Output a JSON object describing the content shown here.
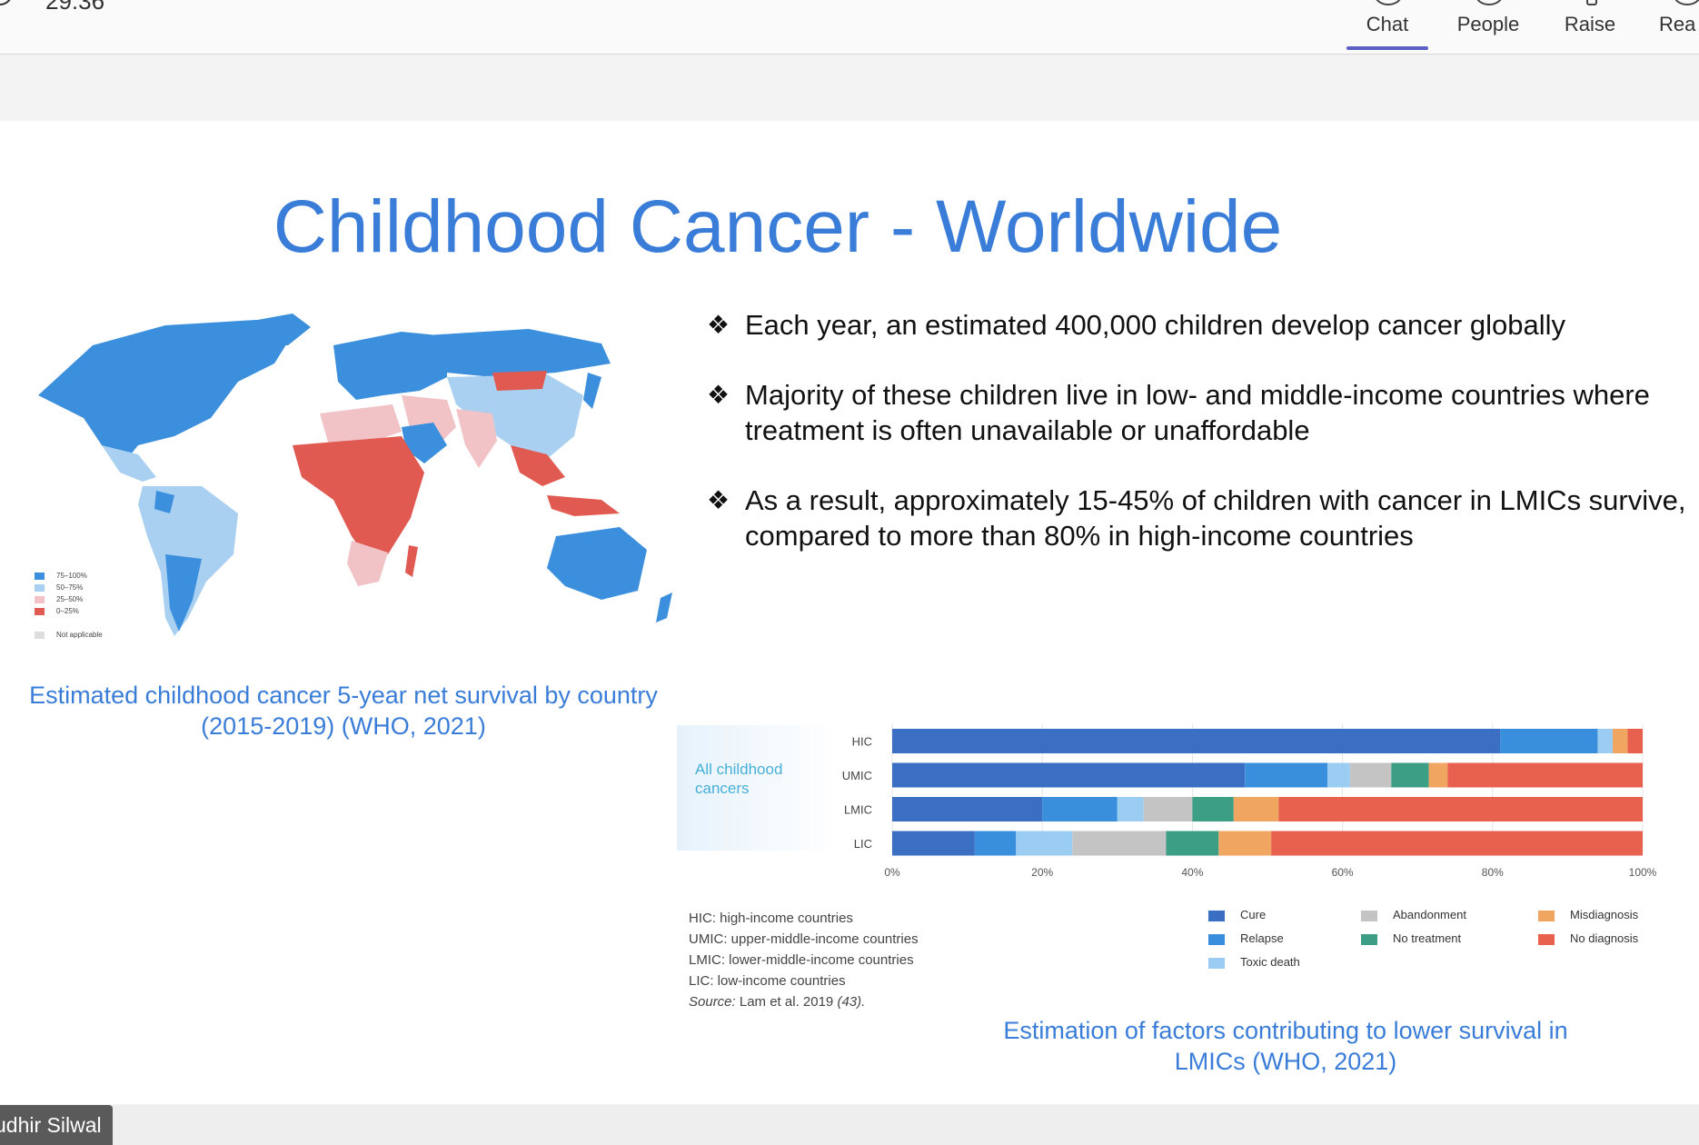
{
  "meeting": {
    "timer": "29:36",
    "toolbar": [
      {
        "label": "Chat",
        "icon": "chat-icon"
      },
      {
        "label": "People",
        "icon": "people-icon"
      },
      {
        "label": "Raise",
        "icon": "raise-hand-icon"
      },
      {
        "label": "Rea",
        "icon": "react-icon"
      }
    ],
    "presenter_name": "udhir Silwal"
  },
  "slide": {
    "title": "Childhood Cancer - Worldwide",
    "bullet_symbol": "❖",
    "bullets": [
      "Each year, an estimated 400,000 children develop cancer globally",
      "Majority of these children live in low- and middle-income countries where treatment is often unavailable or unaffordable",
      "As a result, approximately 15-45% of children with cancer in LMICs survive, compared to more than 80% in high-income countries"
    ],
    "map_legend": [
      {
        "label": "75–100%",
        "color": "#3b8fdd"
      },
      {
        "label": "50–75%",
        "color": "#a9d0f1"
      },
      {
        "label": "25–50%",
        "color": "#f1c3c6"
      },
      {
        "label": "0–25%",
        "color": "#e15a52"
      },
      {
        "label": "Not applicable",
        "color": "#dddddd"
      }
    ],
    "map_caption_line1": "Estimated childhood cancer 5-year net survival by country",
    "map_caption_line2": "(2015-2019) (WHO, 2021)",
    "chart_caption_line1": "Estimation of factors contributing to lower survival in",
    "chart_caption_line2": "LMICs (WHO, 2021)",
    "abbreviations": [
      "HIC: high-income countries",
      "UMIC: upper-middle-income countries",
      "LMIC: lower-middle-income countries",
      "LIC: low-income countries"
    ],
    "source_prefix": "Source:",
    "source_text": " Lam et al. 2019 ",
    "source_ref": "(43)."
  },
  "chart_data": {
    "type": "bar",
    "orientation": "horizontal-stacked",
    "panel_label": "All childhood cancers",
    "categories": [
      "HIC",
      "UMIC",
      "LMIC",
      "LIC"
    ],
    "xlim": [
      0,
      100
    ],
    "x_ticks": [
      "0%",
      "20%",
      "40%",
      "60%",
      "80%",
      "100%"
    ],
    "series": [
      {
        "name": "Cure",
        "color": "#3a6fc4",
        "values": [
          81,
          47,
          20,
          11
        ]
      },
      {
        "name": "Relapse",
        "color": "#3a8fdd",
        "values": [
          13,
          11,
          10,
          5.5
        ]
      },
      {
        "name": "Toxic death",
        "color": "#9bcdf2",
        "values": [
          2,
          3,
          3.5,
          7.5
        ]
      },
      {
        "name": "Abandonment",
        "color": "#c4c4c4",
        "values": [
          0,
          5.5,
          6.5,
          12.5
        ]
      },
      {
        "name": "No treatment",
        "color": "#3c9e85",
        "values": [
          0,
          5,
          5.5,
          7
        ]
      },
      {
        "name": "Misdiagnosis",
        "color": "#f0a560",
        "values": [
          2,
          2.5,
          6,
          7
        ]
      },
      {
        "name": "No diagnosis",
        "color": "#e8604e",
        "values": [
          2,
          26,
          48.5,
          49.5
        ]
      }
    ],
    "legend_position": "bottom-right"
  }
}
